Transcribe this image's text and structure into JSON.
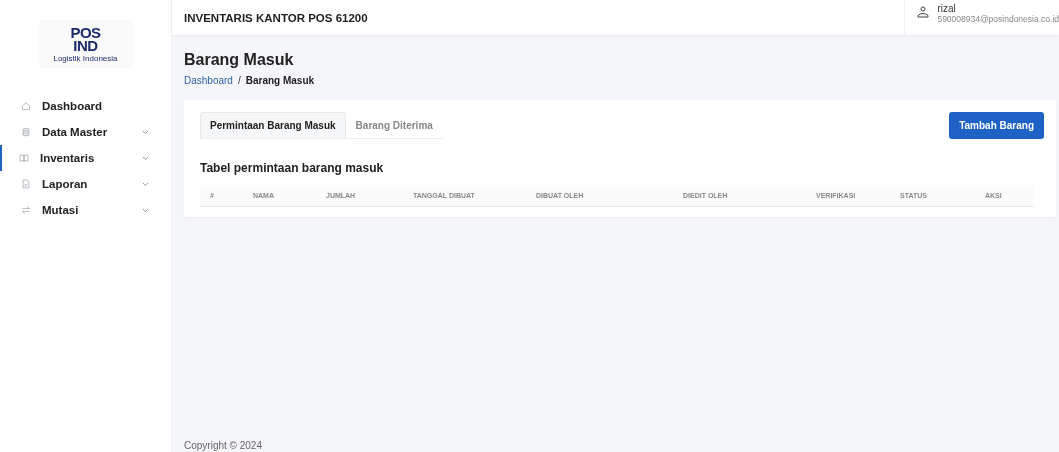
{
  "logo": {
    "line_1": "POS",
    "line_2": "IND",
    "tagline": "Logistik Indonesia"
  },
  "sidebar": {
    "items": [
      {
        "label": "Dashboard",
        "kind": "home",
        "expandable": false,
        "selected": false
      },
      {
        "label": "Data Master",
        "kind": "database",
        "expandable": true,
        "selected": false
      },
      {
        "label": "Inventaris",
        "kind": "book",
        "expandable": true,
        "selected": true
      },
      {
        "label": "Laporan",
        "kind": "file",
        "expandable": true,
        "selected": false
      },
      {
        "label": "Mutasi",
        "kind": "arrows",
        "expandable": true,
        "selected": false
      }
    ]
  },
  "header": {
    "title": "INVENTARIS KANTOR POS 61200",
    "user": {
      "name": "rizal",
      "email": "590008934@posindonesia.co.id"
    }
  },
  "page": {
    "title": "Barang Masuk",
    "breadcrumb_separator": "/",
    "breadcrumb": [
      {
        "label": "Dashboard",
        "link": true
      },
      {
        "label": "Barang Masuk",
        "link": false
      }
    ]
  },
  "card": {
    "tabs": [
      {
        "label": "Permintaan Barang Masuk",
        "selected": true
      },
      {
        "label": "Barang Diterima",
        "selected": false
      }
    ],
    "button": "Tambah Barang",
    "table": {
      "title": "Tabel permintaan barang masuk",
      "columns": [
        "#",
        "NAMA",
        "JUMLAH",
        "TANGGAL DIBUAT",
        "DIBUAT OLEH",
        "DIEDIT OLEH",
        "VERIFIKASI",
        "STATUS",
        "AKSI"
      ]
    }
  },
  "footer": {
    "text": "Copyright © 2024"
  }
}
